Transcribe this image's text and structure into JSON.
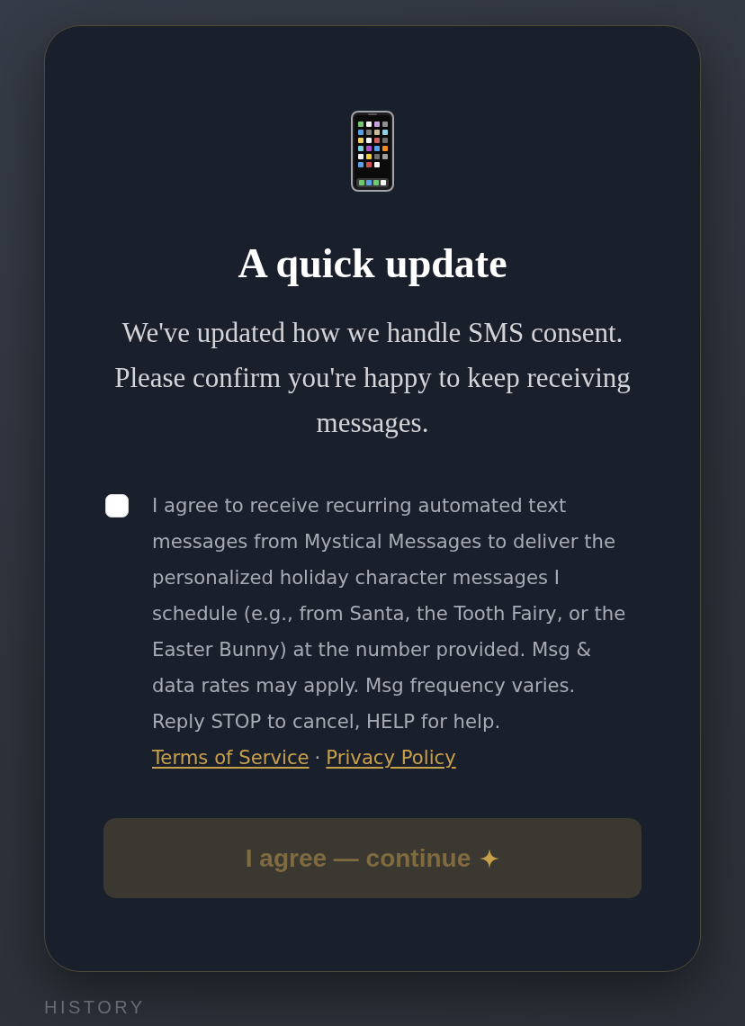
{
  "dialog": {
    "title": "A quick update",
    "message": "We've updated how we handle SMS consent. Please confirm you're happy to keep receiving messages.",
    "consent": {
      "checked": false,
      "text": "I agree to receive recurring automated text messages from Mystical Messages to deliver the personalized holiday character messages I schedule (e.g., from Santa, the Tooth Fairy, or the Easter Bunny) at the number provided. Msg & data rates may apply. Msg frequency varies. Reply STOP to cancel, HELP for help.",
      "links": [
        {
          "label": "Terms of Service"
        },
        {
          "label": "Privacy Policy"
        }
      ],
      "link_separator": "·"
    },
    "button": {
      "label": "I agree — continue",
      "disabled": true
    }
  },
  "background": {
    "section_heading": "HISTORY"
  }
}
